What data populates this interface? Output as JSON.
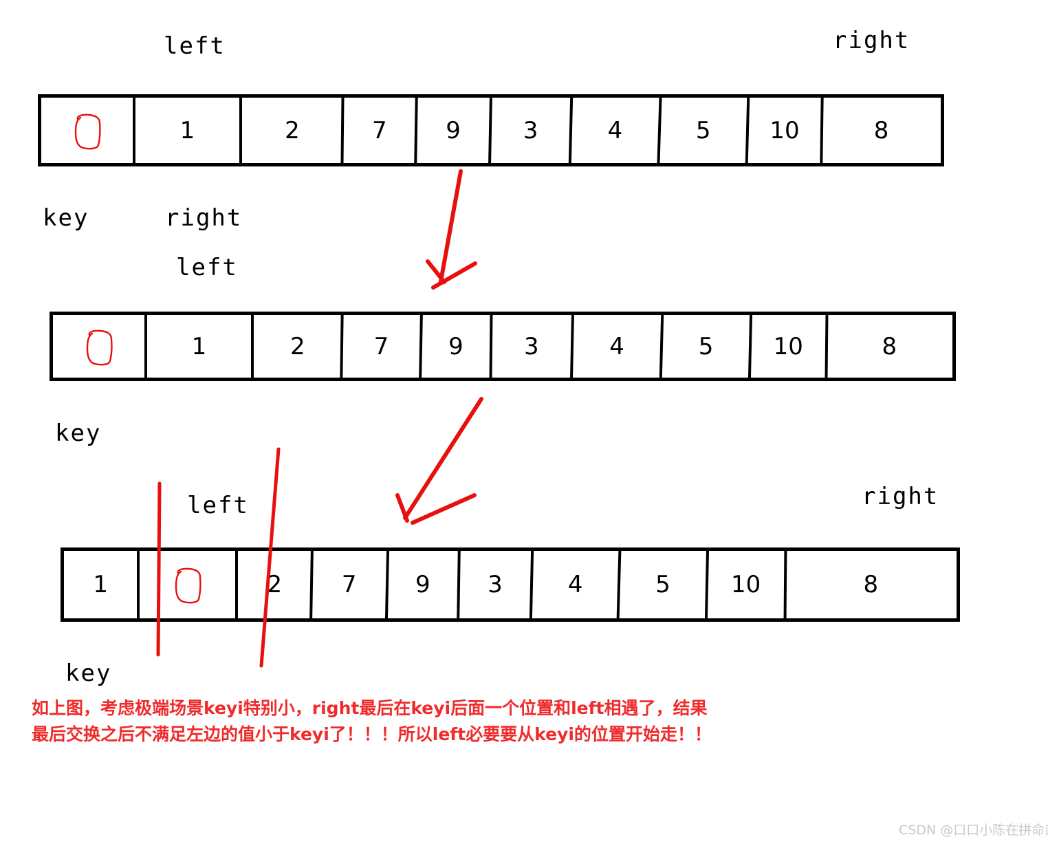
{
  "diagram": {
    "title_note": "quicksort hoare partition edge case illustration",
    "accent_red": "#ef2b2b",
    "ink_red": "#e8100f",
    "rows": [
      {
        "id": "row-1",
        "cells": [
          {
            "value": "",
            "is_key": true
          },
          {
            "value": "1"
          },
          {
            "value": "2"
          },
          {
            "value": "7"
          },
          {
            "value": "9"
          },
          {
            "value": "3"
          },
          {
            "value": "4"
          },
          {
            "value": "5"
          },
          {
            "value": "10"
          },
          {
            "value": "8"
          }
        ]
      },
      {
        "id": "row-2",
        "cells": [
          {
            "value": "",
            "is_key": true
          },
          {
            "value": "1"
          },
          {
            "value": "2"
          },
          {
            "value": "7"
          },
          {
            "value": "9"
          },
          {
            "value": "3"
          },
          {
            "value": "4"
          },
          {
            "value": "5"
          },
          {
            "value": "10"
          },
          {
            "value": "8"
          }
        ]
      },
      {
        "id": "row-3",
        "cells": [
          {
            "value": "1"
          },
          {
            "value": "",
            "is_key": true
          },
          {
            "value": "2"
          },
          {
            "value": "7"
          },
          {
            "value": "9"
          },
          {
            "value": "3"
          },
          {
            "value": "4"
          },
          {
            "value": "5"
          },
          {
            "value": "10"
          },
          {
            "value": "8"
          }
        ]
      }
    ],
    "labels": {
      "r1_left": "left",
      "r1_right": "right",
      "r2_key": "key",
      "r2_right": "right",
      "r2_left": "left",
      "r3_key": "key",
      "r3_left": "left",
      "r3_right": "right",
      "r3_key_bottom": "key"
    }
  },
  "annotation": {
    "line1": "如上图，考虑极端场景keyi特别小，right最后在keyi后面一个位置和left相遇了，结果",
    "line2": "最后交换之后不满足左边的值小于keyi了！！！所以left必要要从keyi的位置开始走！！"
  },
  "watermark": {
    "text": "CSDN @⼝⼝小陈在拼命⼝⼝"
  }
}
